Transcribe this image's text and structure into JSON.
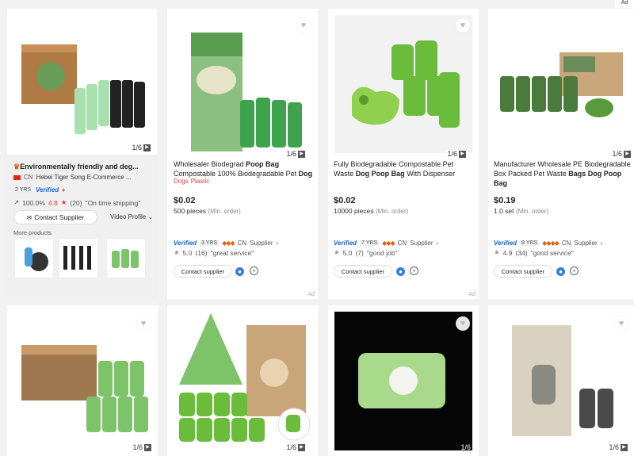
{
  "ad_top_label": "Ad",
  "featured": {
    "title": "Environmentally friendly and deg...",
    "country": "CN",
    "company": "Hebei Tiger Song E-Commerce ...",
    "years": "2 YRS",
    "verified": "Verified",
    "response_rate": "100.0%",
    "rating": "4.8",
    "reviews": "(20)",
    "review_quote": "\"On time shipping\"",
    "contact_label": "Contact Supplier",
    "video_label": "Video Profile",
    "more_products_label": "More products",
    "counter": "1/6"
  },
  "products": [
    {
      "title_a": "Wholesaler Biodegrad ",
      "title_b": "Poop Bag",
      "title_c": " Compostable 100% Biodegradable Pet ",
      "title_d": "Dog",
      "tag1": "Dogs",
      "tag2": "Plastic",
      "price": "$0.02",
      "moq_qty": "500 pieces",
      "moq_label": "(Min. order)",
      "verified": "Verified",
      "years": "3 YRS",
      "country": "CN",
      "supplier": "Supplier",
      "rating": "5.0",
      "reviews": "(16)",
      "quote": "\"great service\"",
      "contact": "Contact supplier",
      "counter": "1/6",
      "ad": "Ad"
    },
    {
      "title_a": "Fully Biodegradable Compostable Pet Waste ",
      "title_b": "Dog Poop Bag",
      "title_c": " With Dispenser",
      "title_d": "",
      "price": "$0.02",
      "moq_qty": "10000 pieces",
      "moq_label": "(Min. order)",
      "verified": "Verified",
      "years": "7 YRS",
      "country": "CN",
      "supplier": "Supplier",
      "rating": "5.0",
      "reviews": "(7)",
      "quote": "\"good job\"",
      "contact": "Contact supplier",
      "counter": "1/6",
      "ad": "Ad"
    },
    {
      "title_a": "Manufacturer Wholesale PE Biodegradable Box Packed Pet Waste ",
      "title_b": "Bags Dog Poop Bag",
      "title_c": "",
      "title_d": "",
      "price": "$0.19",
      "moq_qty": "1.0 set",
      "moq_label": "(Min. order)",
      "verified": "Verified",
      "years": "8 YRS",
      "country": "CN",
      "supplier": "Supplier",
      "rating": "4.9",
      "reviews": "(34)",
      "quote": "\"good service\"",
      "contact": "Contact supplier",
      "counter": "1/6"
    }
  ],
  "bottom": [
    {
      "counter": "1/6"
    },
    {
      "counter": "1/6"
    },
    {
      "counter": "1/6"
    },
    {
      "counter": "1/6"
    }
  ],
  "colors": {
    "accent_red": "#e4393c",
    "verified_blue": "#1a66d6",
    "medal_orange": "#e2621b",
    "bag_green": "#7cc36a"
  }
}
